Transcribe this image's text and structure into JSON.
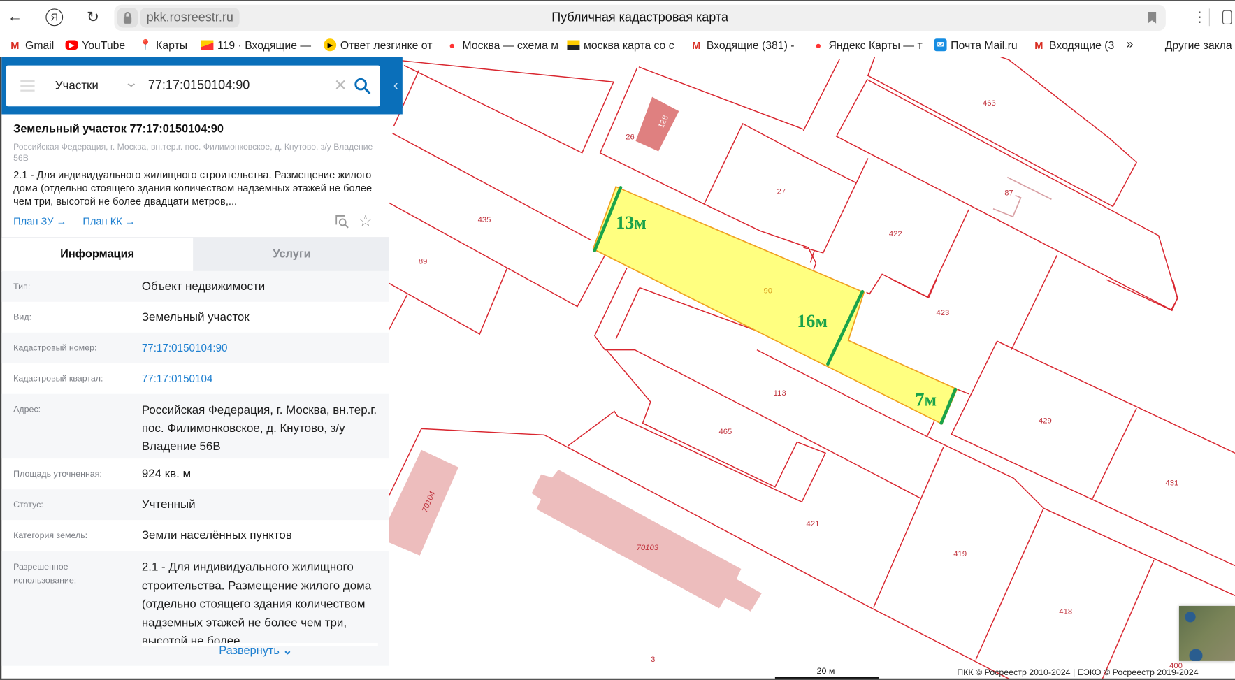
{
  "browser": {
    "domain": "pkk.rosreestr.ru",
    "page_title": "Публичная кадастровая карта",
    "bookmarks": [
      {
        "label": "Gmail",
        "icon": "gmail-icon"
      },
      {
        "label": "YouTube",
        "icon": "youtube-icon"
      },
      {
        "label": "Карты",
        "icon": "google-maps-icon"
      },
      {
        "label": "119 · Входящие —",
        "icon": "yandex-mail-icon"
      },
      {
        "label": "Ответ лезгинке от",
        "icon": "play-icon"
      },
      {
        "label": "Москва — схема м",
        "icon": "map-pin-icon"
      },
      {
        "label": "москва карта со с",
        "icon": "image-icon"
      },
      {
        "label": "Входящие (381) -",
        "icon": "gmail-icon"
      },
      {
        "label": "Яндекс Карты — т",
        "icon": "map-pin-icon"
      },
      {
        "label": "Почта Mail.ru",
        "icon": "mailru-icon"
      },
      {
        "label": "Входящие (3",
        "icon": "gmail-icon"
      }
    ],
    "more": "»",
    "other_bookmarks": "Другие закла"
  },
  "search": {
    "category": "Участки",
    "query": "77:17:0150104:90"
  },
  "card": {
    "title": "Земельный участок 77:17:0150104:90",
    "address": "Российская Федерация, г. Москва, вн.тер.г. пос. Филимонковское, д. Кнутово, з/у Владение 56В",
    "description": "2.1 - Для индивидуального жилищного строительства. Размещение жилого дома (отдельно стоящего здания количеством надземных этажей не более чем три, высотой не более двадцати метров,...",
    "link_plan_zu": "План ЗУ →",
    "link_plan_kk": "План КК →"
  },
  "tabs": {
    "info": "Информация",
    "services": "Услуги"
  },
  "info": [
    {
      "label": "Тип:",
      "value": "Объект недвижимости"
    },
    {
      "label": "Вид:",
      "value": "Земельный участок"
    },
    {
      "label": "Кадастровый номер:",
      "value": "77:17:0150104:90"
    },
    {
      "label": "Кадастровый квартал:",
      "value": "77:17:0150104"
    },
    {
      "label": "Адрес:",
      "value": "Российская Федерация, г. Москва, вн.тер.г. пос. Филимонковское, д. Кнутово, з/у Владение 56В"
    },
    {
      "label": "Площадь уточненная:",
      "value": "924 кв. м"
    },
    {
      "label": "Статус:",
      "value": "Учтенный"
    },
    {
      "label": "Категория земель:",
      "value": "Земли населённых пунктов"
    },
    {
      "label": "Разрешенное использование:",
      "value": "2.1 - Для индивидуального жилищного строительства. Размещение жилого дома (отдельно стоящего здания количеством надземных этажей не более чем три, высотой не более"
    }
  ],
  "expand_label": "Развернуть",
  "map": {
    "labels": [
      "26",
      "128",
      "435",
      "89",
      "27",
      "463",
      "87",
      "422",
      "90",
      "423",
      "113",
      "465",
      "429",
      "431",
      "421",
      "419",
      "418",
      "400",
      "3",
      "70103",
      "70104"
    ],
    "measurements": [
      "13м",
      "16м",
      "7м"
    ],
    "scale": "20 м",
    "attribution": "ПКК © Росреестр 2010-2024 | ЕЭКО © Росреестр 2019-2024",
    "colors": {
      "boundary": "#d9262f",
      "selected_fill": "#ffff80",
      "selected_stroke": "#f0a020",
      "measure": "#1aa34a",
      "building": "#edbdbd"
    }
  }
}
